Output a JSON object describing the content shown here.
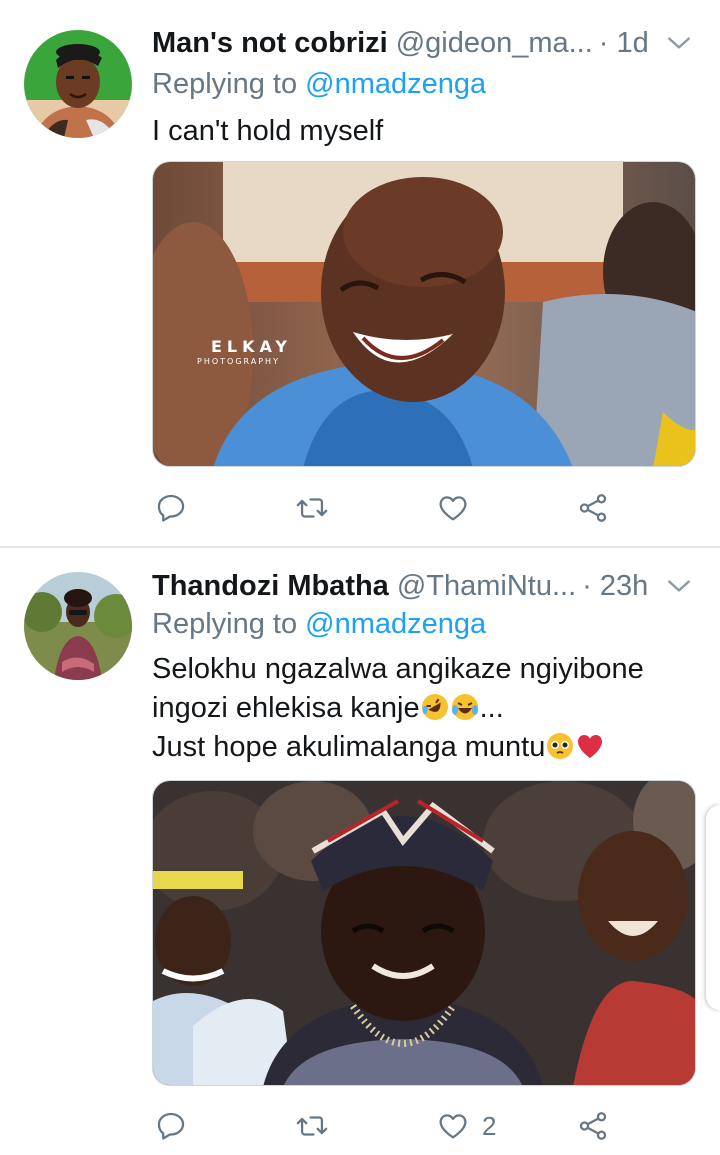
{
  "tweets": [
    {
      "display_name": "Man's not cobrizi",
      "handle": "@gideon_ma...",
      "time": "· 1d",
      "replying_prefix": "Replying to",
      "replying_to": "@nmadzenga",
      "text_lines": [
        "I can't hold myself"
      ],
      "media": {
        "watermark_line1": "ELKAY",
        "watermark_line2": "PHOTOGRAPHY"
      },
      "like_count": ""
    },
    {
      "display_name": "Thandozi Mbatha",
      "handle": "@ThamiNtu...",
      "time": "· 23h",
      "replying_prefix": "Replying to",
      "replying_to": "@nmadzenga",
      "text_lines": [
        "Selokhu ngazalwa angikaze ngiyibone",
        "ingozi ehlekisa kanje",
        "...",
        "Just hope akulimalanga muntu"
      ],
      "like_count": "2"
    }
  ],
  "icons": {
    "reply": "reply-icon",
    "retweet": "retweet-icon",
    "like": "heart-icon",
    "share": "share-icon",
    "more": "chevron-down-icon"
  },
  "colors": {
    "link": "#1da1f2",
    "secondary": "#657786",
    "divider": "#e1e8ed"
  }
}
